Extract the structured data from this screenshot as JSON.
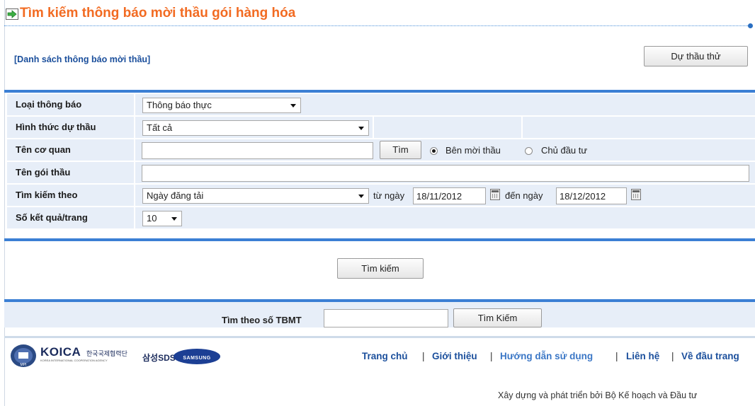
{
  "page": {
    "title": "Tìm kiếm thông báo mời thầu gói hàng hóa",
    "list_link": "[Danh sách thông báo mời thầu]",
    "trial_button": "Dự thầu thử"
  },
  "form": {
    "notice_type": {
      "label": "Loại thông báo",
      "value": "Thông báo thực"
    },
    "bid_form": {
      "label": "Hình thức dự thầu",
      "value": "Tất cả"
    },
    "agency": {
      "label": "Tên cơ quan",
      "value": "",
      "search_button": "Tìm",
      "radio_options": [
        {
          "label": "Bên mời thầu",
          "selected": true
        },
        {
          "label": "Chủ đầu tư",
          "selected": false
        }
      ]
    },
    "package_name": {
      "label": "Tên gói thầu",
      "value": ""
    },
    "search_by": {
      "label": "Tìm kiếm theo",
      "value": "Ngày đăng tải",
      "from_label": "từ ngày",
      "from_date": "18/11/2012",
      "to_label": "đến ngày",
      "to_date": "18/12/2012"
    },
    "results_per_page": {
      "label": "Số kết quả/trang",
      "value": "10"
    },
    "search_button": "Tìm kiếm"
  },
  "tbmt_search": {
    "label": "Tìm theo số TBMT",
    "value": "",
    "button": "Tìm Kiếm"
  },
  "footer": {
    "logos": [
      "KOICA",
      "한국국제협력단",
      "삼성SDS",
      "SAMSUNG"
    ],
    "koica_sub": "KOREA INTERNATIONAL COOPERATION AGENCY",
    "nav": [
      {
        "label": "Trang chủ"
      },
      {
        "label": "Giới thiệu"
      },
      {
        "label": "Hướng dẫn sử dụng"
      },
      {
        "label": "Liên hệ"
      },
      {
        "label": "Về đầu trang"
      }
    ],
    "separator": "|",
    "credit": "Xây dựng và phát triển bởi Bộ Kế hoạch và Đầu tư"
  },
  "colors": {
    "title": "#f26b22",
    "link": "#1b4f9c",
    "band": "#3b7fd4",
    "row_bg": "#e7eef8"
  }
}
